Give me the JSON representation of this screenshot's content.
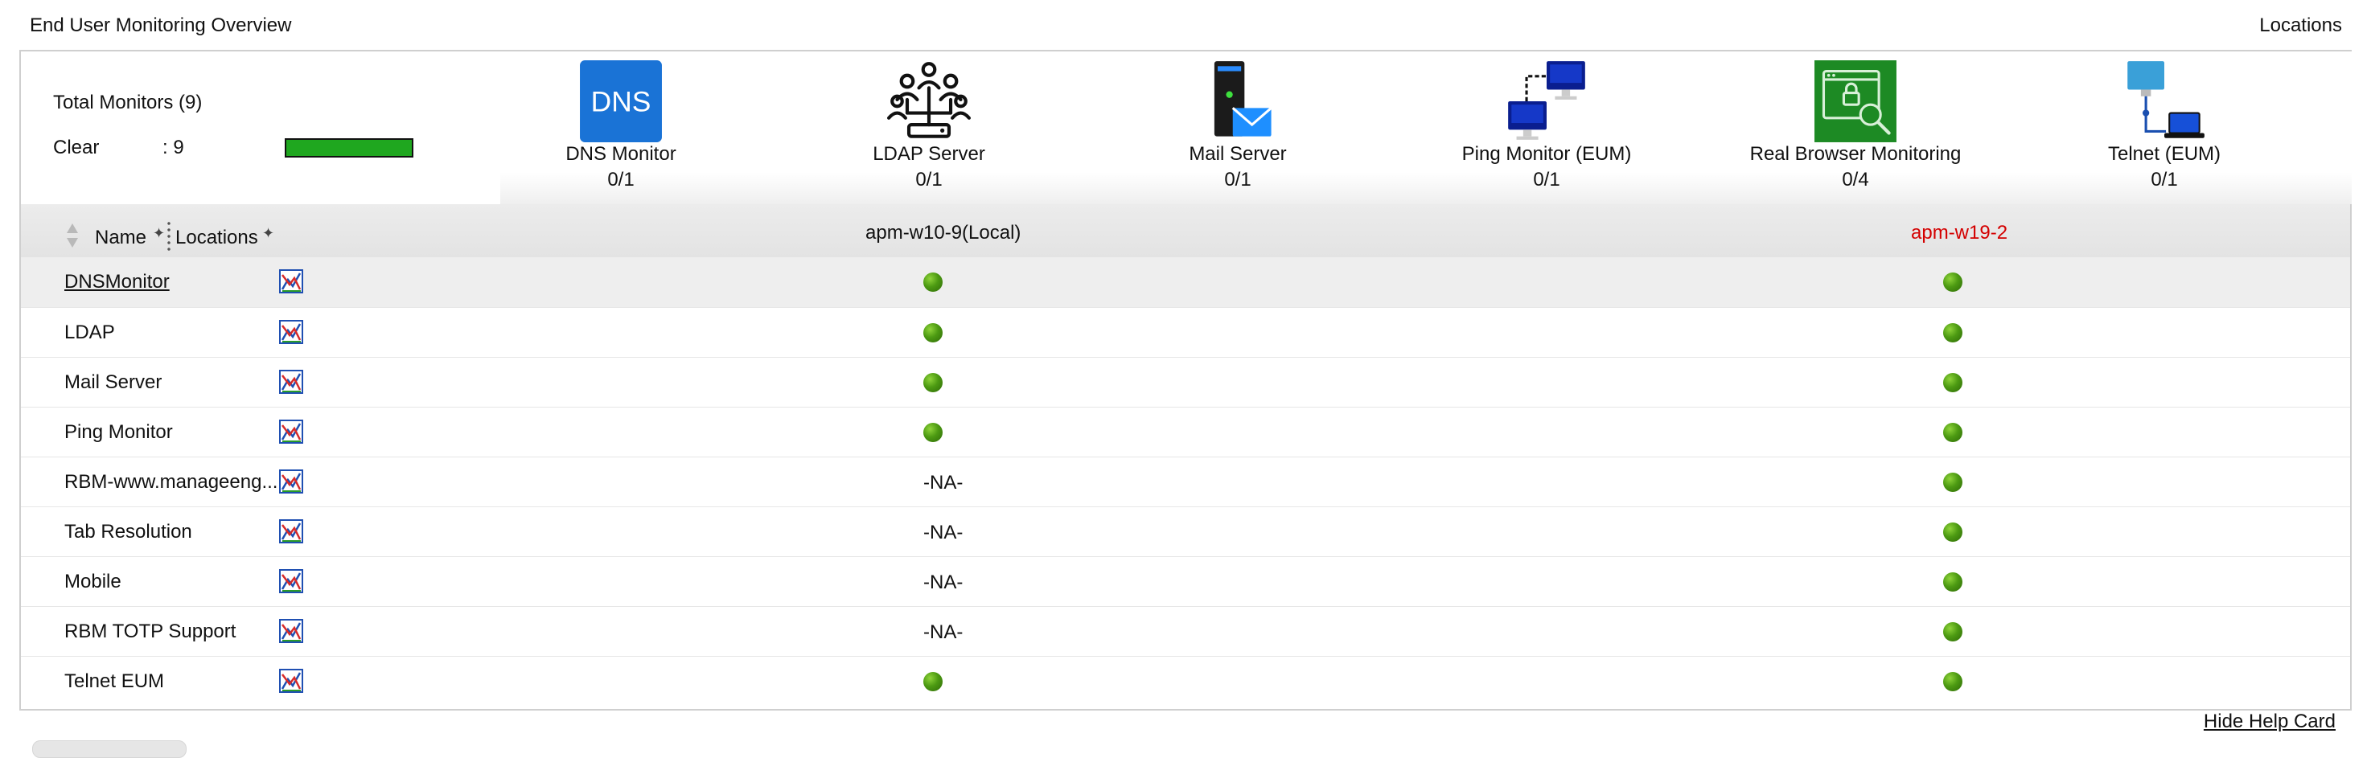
{
  "header": {
    "title": "End User Monitoring Overview",
    "locations_link": "Locations"
  },
  "summary": {
    "total_label": "Total Monitors (9)",
    "clear_label": "Clear",
    "clear_count": ": 9",
    "clear_fraction": 1.0,
    "clear_color": "#1fa71f"
  },
  "monitor_types": [
    {
      "name": "DNS Monitor",
      "count": "0/1",
      "icon": "dns-icon",
      "icon_text": "DNS"
    },
    {
      "name": "LDAP Server",
      "count": "0/1",
      "icon": "ldap-network-icon"
    },
    {
      "name": "Mail Server",
      "count": "0/1",
      "icon": "mail-server-icon"
    },
    {
      "name": "Ping Monitor (EUM)",
      "count": "0/1",
      "icon": "ping-monitors-icon"
    },
    {
      "name": "Real Browser Monitoring",
      "count": "0/4",
      "icon": "browser-search-icon"
    },
    {
      "name": "Telnet (EUM)",
      "count": "0/1",
      "icon": "telnet-icon"
    }
  ],
  "table": {
    "headers": {
      "name": "Name",
      "locations": "Locations",
      "location_a": "apm-w10-9(Local)",
      "location_b": "apm-w19-2"
    },
    "rows": [
      {
        "name": "DNSMonitor",
        "a": "up",
        "b": "up"
      },
      {
        "name": "LDAP",
        "a": "up",
        "b": "up"
      },
      {
        "name": "Mail Server",
        "a": "up",
        "b": "up"
      },
      {
        "name": "Ping Monitor",
        "a": "up",
        "b": "up"
      },
      {
        "name": "RBM-www.manageeng...",
        "a": "-NA-",
        "b": "up"
      },
      {
        "name": "Tab Resolution",
        "a": "-NA-",
        "b": "up"
      },
      {
        "name": "Mobile",
        "a": "-NA-",
        "b": "up"
      },
      {
        "name": "RBM TOTP Support",
        "a": "-NA-",
        "b": "up"
      },
      {
        "name": "Telnet EUM",
        "a": "up",
        "b": "up"
      }
    ]
  },
  "footer": {
    "hide_help": "Hide Help Card"
  },
  "colors": {
    "status_up": "#4c9a12",
    "alert_location": "#d40000"
  }
}
